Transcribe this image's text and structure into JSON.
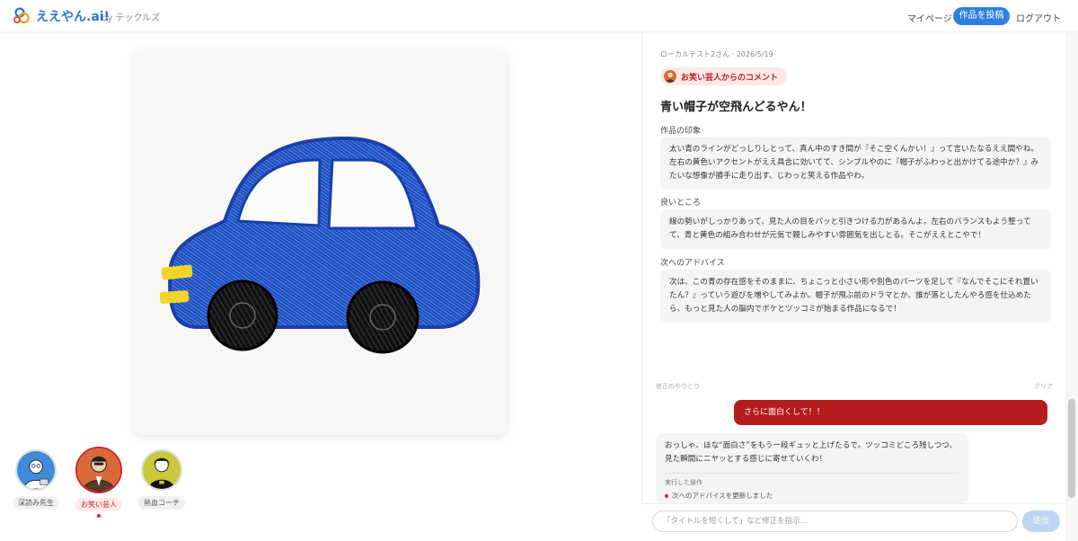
{
  "header": {
    "logo_text": "ええやん.ai!",
    "logo_by": "by テックルズ",
    "nav": {
      "mypage": "マイページ",
      "post": "作品を投稿",
      "logout": "ログアウト"
    }
  },
  "personas": [
    {
      "label": "深読み先生",
      "active": false
    },
    {
      "label": "お笑い芸人",
      "active": true
    },
    {
      "label": "熱血コーチ",
      "active": false
    }
  ],
  "comment": {
    "meta": "ローカルテスト2さん · 2026/5/19",
    "badge": "お笑い芸人からのコメント",
    "title": "青い帽子が空飛んどるやん！",
    "sections": [
      {
        "label": "作品の印象",
        "text": "太い青のラインがどっしりしとって、真ん中のすき間が『そこ空くんかい！』って言いたなるええ間やね。左右の黄色いアクセントがええ具合に効いてて、シンプルやのに『帽子がふわっと出かけてる途中か？』みたいな想像が勝手に走り出す、じわっと笑える作品やわ。"
      },
      {
        "label": "良いところ",
        "text": "線の勢いがしっかりあって、見た人の目をパッと引きつける力があるんよ。左右のバランスもよう整ってて、青と黄色の組み合わせが元気で親しみやすい雰囲気を出しとる。そこがええとこやで！"
      },
      {
        "label": "次へのアドバイス",
        "text": "次は、この青の存在感をそのままに、ちょこっと小さい形や別色のパーツを足して『なんでそこにそれ置いたん？』っていう遊びを増やしてみよか。帽子が飛ぶ前のドラマとか、誰が落としたんやろ感を仕込めたら、もっと見た人の脳内でボケとツッコミが始まる作品になるで！"
      }
    ]
  },
  "chat": {
    "divider_left": "修正のやりとり",
    "divider_right": "クリア",
    "user_message": "さらに面白くして！！",
    "bot_message": "おっしゃ、ほな“面白さ”をもう一段ギュッと上げたるで。ツッコミどころ残しつつ、見た瞬間にニヤッとする感じに寄せていくわ！",
    "action_label": "実行した操作",
    "action_item": "次へのアドバイスを更新しました",
    "input_placeholder": "「タイトルを短くして」など修正を指示...",
    "input_value": "",
    "send_label": "送信"
  },
  "colors": {
    "brand_blue": "#2f7fe0",
    "accent_red": "#b51c1c",
    "badge_bg": "#fde8e8"
  },
  "icons": {
    "logo": "eeyan-logo-icon",
    "send": "send-button"
  }
}
